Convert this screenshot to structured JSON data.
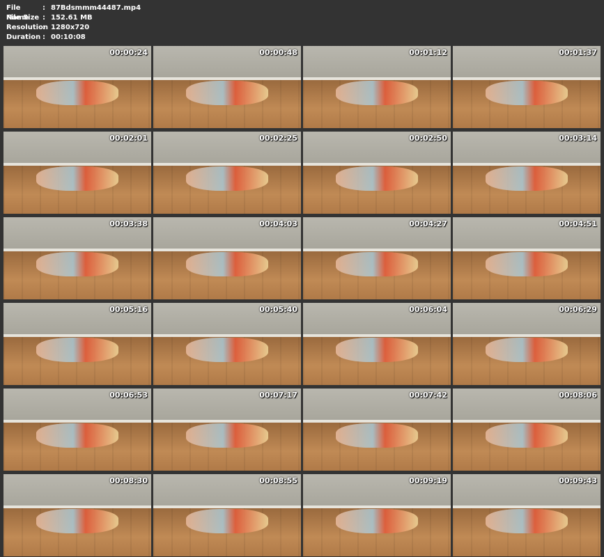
{
  "info": {
    "file_name_label": "File Name",
    "file_name": "87Bdsmmm44487.mp4",
    "file_size_label": "File Size",
    "file_size": "152.61 MB",
    "resolution_label": "Resolution",
    "resolution": "1280x720",
    "duration_label": "Duration",
    "duration": "00:10:08",
    "separator": ":"
  },
  "thumbnails": [
    "00:00:24",
    "00:00:48",
    "00:01:12",
    "00:01:37",
    "00:02:01",
    "00:02:25",
    "00:02:50",
    "00:03:14",
    "00:03:38",
    "00:04:03",
    "00:04:27",
    "00:04:51",
    "00:05:16",
    "00:05:40",
    "00:06:04",
    "00:06:29",
    "00:06:53",
    "00:07:17",
    "00:07:42",
    "00:08:06",
    "00:08:30",
    "00:08:55",
    "00:09:19",
    "00:09:43"
  ],
  "colors": {
    "background": "#333333",
    "text": "#ffffff"
  }
}
